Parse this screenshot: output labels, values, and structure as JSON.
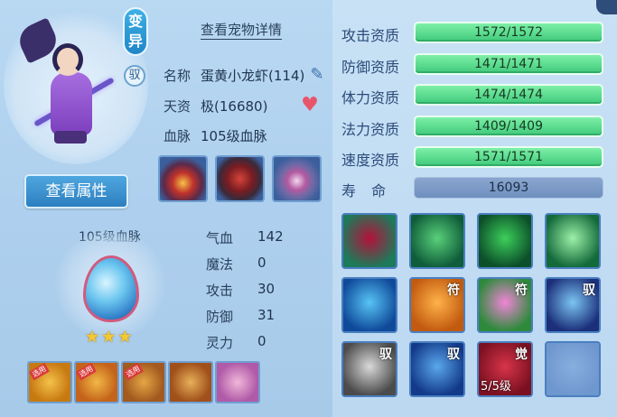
{
  "pet": {
    "badge_bianyi": "变异",
    "badge_yu": "驭",
    "details_link": "查看宠物详情",
    "name_label": "名称",
    "name_value": "蛋黄小龙虾(114)",
    "talent_label": "天资",
    "talent_value": "极(16680)",
    "blood_label": "血脉",
    "blood_value": "105级血脉",
    "view_attr_button": "查看属性"
  },
  "bloodline": {
    "title": "105级血脉",
    "stars": "★★★"
  },
  "stats": [
    {
      "label": "气血",
      "value": "142"
    },
    {
      "label": "魔法",
      "value": "0"
    },
    {
      "label": "攻击",
      "value": "30"
    },
    {
      "label": "防御",
      "value": "31"
    },
    {
      "label": "灵力",
      "value": "0"
    }
  ],
  "small_skills": [
    {
      "name": "skill-a",
      "tag": "选用",
      "colors": [
        "#c87a12",
        "#f4c24a"
      ]
    },
    {
      "name": "skill-b",
      "tag": "选用",
      "colors": [
        "#c4641a",
        "#f2b846"
      ]
    },
    {
      "name": "skill-c",
      "tag": "选用",
      "colors": [
        "#a35a1f",
        "#e5a645"
      ]
    },
    {
      "name": "skill-d",
      "tag": "",
      "colors": [
        "#a0501a",
        "#e7b05a"
      ]
    },
    {
      "name": "skill-e",
      "tag": "",
      "colors": [
        "#b05aa8",
        "#f1b7d8"
      ]
    }
  ],
  "aptitudes": [
    {
      "label": "攻击资质",
      "value": "1572/1572"
    },
    {
      "label": "防御资质",
      "value": "1471/1471"
    },
    {
      "label": "体力资质",
      "value": "1474/1474"
    },
    {
      "label": "法力资质",
      "value": "1409/1409"
    },
    {
      "label": "速度资质",
      "value": "1571/1571"
    }
  ],
  "life": {
    "label": "寿  命",
    "value": "16093"
  },
  "skills": [
    {
      "name": "blood-drop-skill",
      "mark": "",
      "level": "",
      "colors": [
        "#1d7a5a",
        "#b3123a"
      ]
    },
    {
      "name": "leap-skill",
      "mark": "",
      "level": "",
      "colors": [
        "#0f5d3a",
        "#59d07a"
      ]
    },
    {
      "name": "muscle-skill",
      "mark": "",
      "level": "",
      "colors": [
        "#0c4f2a",
        "#3ccf5a"
      ]
    },
    {
      "name": "shatter-skill",
      "mark": "",
      "level": "",
      "colors": [
        "#136a3a",
        "#9df0a8"
      ]
    },
    {
      "name": "water-orb-skill",
      "mark": "",
      "level": "",
      "colors": [
        "#0f4a9a",
        "#58c4f5"
      ]
    },
    {
      "name": "fire-skill",
      "mark": "符",
      "level": "",
      "colors": [
        "#c25a0f",
        "#ffb24a"
      ]
    },
    {
      "name": "heart-skill",
      "mark": "符",
      "level": "",
      "colors": [
        "#2c8a3a",
        "#f084d6"
      ]
    },
    {
      "name": "crystal-skill",
      "mark": "驭",
      "level": "",
      "colors": [
        "#1b2f7a",
        "#7cc5f2"
      ]
    },
    {
      "name": "beast-skill",
      "mark": "驭",
      "level": "",
      "colors": [
        "#4b4b4b",
        "#d9d9d9"
      ]
    },
    {
      "name": "shield-skill",
      "mark": "驭",
      "level": "",
      "colors": [
        "#133a8a",
        "#5aa8ec"
      ]
    },
    {
      "name": "awaken-skill",
      "mark": "觉",
      "level": "5/5级",
      "colors": [
        "#7a1020",
        "#d8344a"
      ]
    },
    {
      "name": "empty-slot",
      "mark": "",
      "level": "",
      "colors": [
        "#6f97cf",
        "#88aede"
      ]
    }
  ]
}
